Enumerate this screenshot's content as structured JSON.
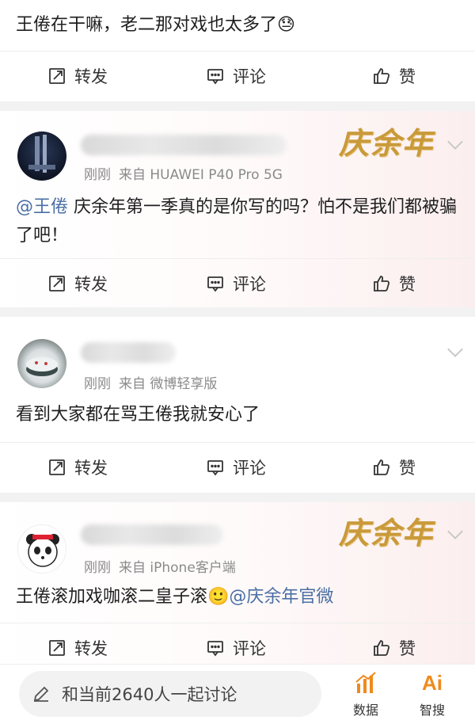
{
  "posts": [
    {
      "text": "王倦在干嘛，老二那对戏也太多了",
      "emoji": "😓",
      "actions": {
        "forward": "转发",
        "comment": "评论",
        "like": "赞"
      }
    },
    {
      "meta_time": "刚刚",
      "meta_source": "来自 HUAWEI P40 Pro 5G",
      "brand": "庆余年",
      "mention": "@王倦",
      "text": " 庆余年第一季真的是你写的吗？怕不是我们都被骗了吧！",
      "actions": {
        "forward": "转发",
        "comment": "评论",
        "like": "赞"
      }
    },
    {
      "meta_time": "刚刚",
      "meta_source": "来自 微博轻享版",
      "text": "看到大家都在骂王倦我就安心了",
      "actions": {
        "forward": "转发",
        "comment": "评论",
        "like": "赞"
      }
    },
    {
      "meta_time": "刚刚",
      "meta_source": "来自 iPhone客户端",
      "brand": "庆余年",
      "text": "王倦滚加戏咖滚二皇子滚",
      "emoji": "🙂",
      "mention": "@庆余年官微",
      "actions": {
        "forward": "转发",
        "comment": "评论",
        "like": "赞"
      }
    }
  ],
  "bottom_bar": {
    "input_placeholder": "和当前2640人一起讨论",
    "tool_data": "数据",
    "tool_ai": "智搜",
    "ai_badge": "Ai"
  },
  "colors": {
    "mention": "#4a6fa5",
    "brand_gold": "#c99a3a",
    "ai_orange": "#f08a1c"
  }
}
